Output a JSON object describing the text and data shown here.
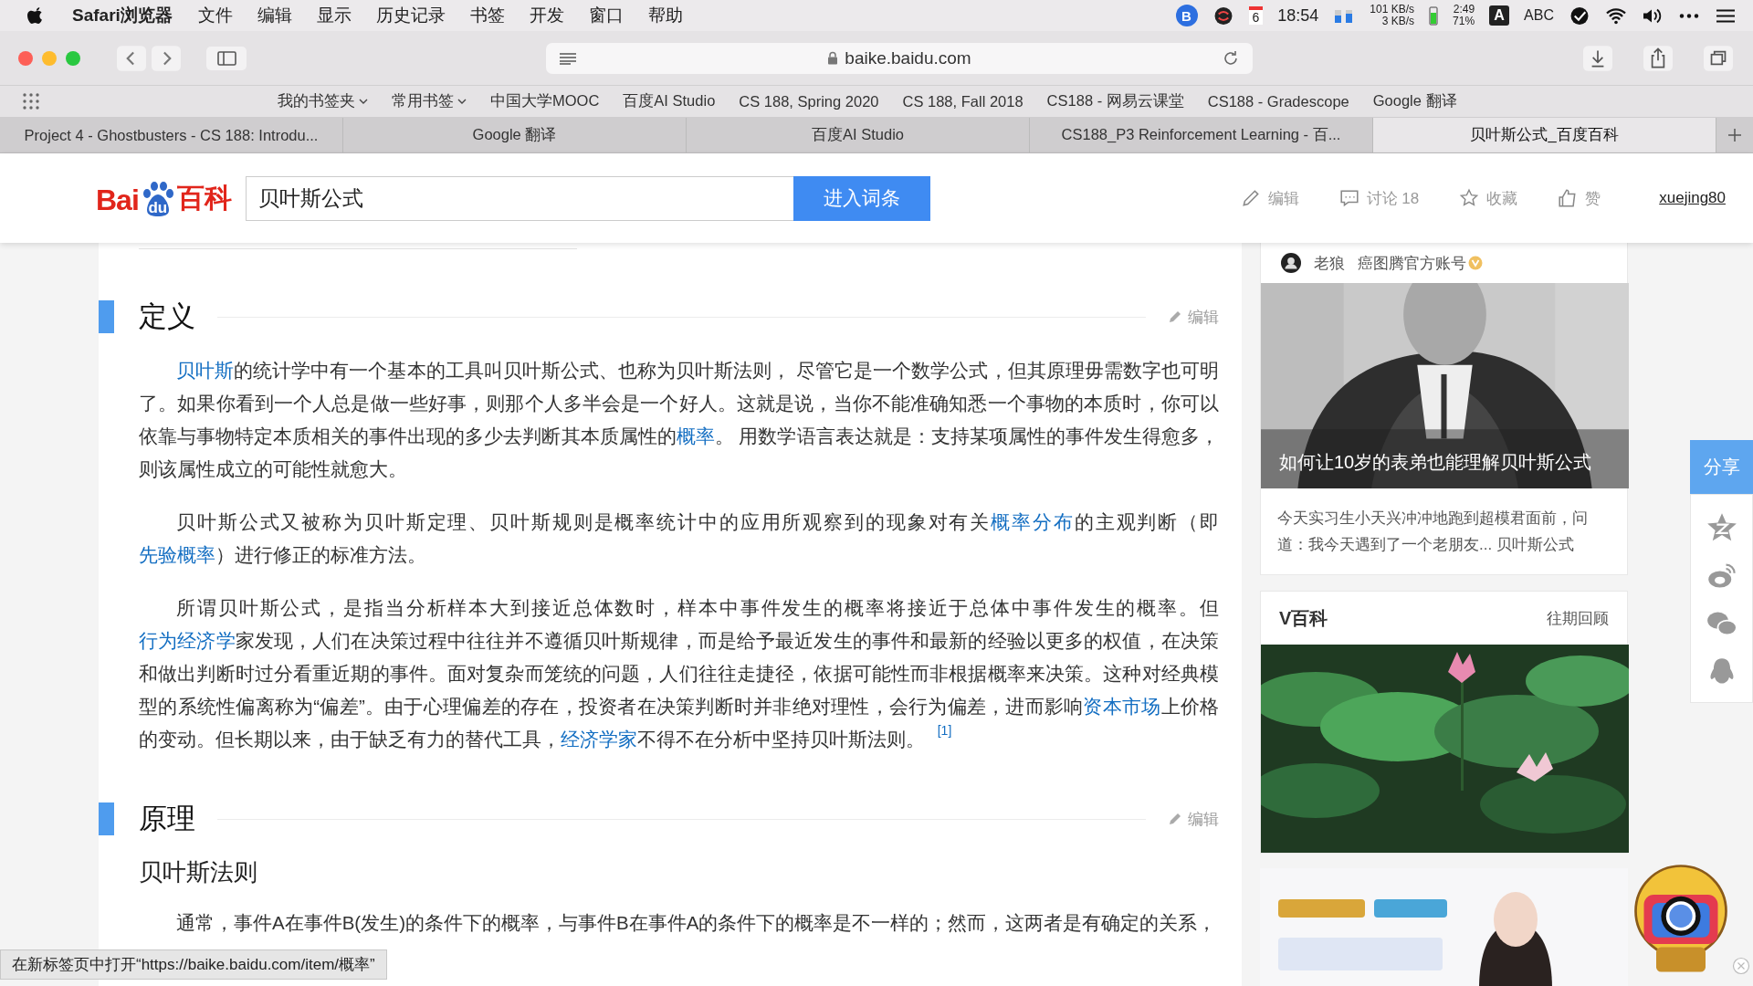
{
  "menu_bar": {
    "app": "Safari浏览器",
    "items": [
      "文件",
      "编辑",
      "显示",
      "历史记录",
      "书签",
      "开发",
      "窗口",
      "帮助"
    ],
    "status": {
      "app_badge": "B",
      "date": "6",
      "time": "18:54",
      "net_up": "101 KB/s",
      "net_down": "3 KB/s",
      "battery_time": "2:49",
      "battery_percent": "71%",
      "input_badge": "A",
      "input": "ABC"
    }
  },
  "toolbar": {
    "url": "baike.baidu.com"
  },
  "bookmarks": [
    {
      "label": "我的书签夹",
      "dropdown": true
    },
    {
      "label": "常用书签",
      "dropdown": true
    },
    {
      "label": "中国大学MOOC",
      "dropdown": false
    },
    {
      "label": "百度AI Studio",
      "dropdown": false
    },
    {
      "label": "CS 188, Spring 2020",
      "dropdown": false
    },
    {
      "label": "CS 188, Fall 2018",
      "dropdown": false
    },
    {
      "label": "CS188 - 网易云课堂",
      "dropdown": false
    },
    {
      "label": "CS188 - Gradescope",
      "dropdown": false
    },
    {
      "label": "Google 翻译",
      "dropdown": false
    }
  ],
  "tabs": [
    {
      "label": "Project 4 - Ghostbusters - CS 188: Introdu...",
      "selected": false
    },
    {
      "label": "Google 翻译",
      "selected": false
    },
    {
      "label": "百度AI Studio",
      "selected": false
    },
    {
      "label": "CS188_P3 Reinforcement Learning - 百...",
      "selected": false
    },
    {
      "label": "贝叶斯公式_百度百科",
      "selected": true
    }
  ],
  "header": {
    "logo": {
      "left": "Bai",
      "paw": "du",
      "right": "百科"
    },
    "search": {
      "value": "贝叶斯公式"
    },
    "search_button": "进入词条",
    "actions": [
      {
        "kind": "edit",
        "label": "编辑"
      },
      {
        "kind": "discuss",
        "label": "讨论 18"
      },
      {
        "kind": "collect",
        "label": "收藏"
      },
      {
        "kind": "like",
        "label": "赞"
      }
    ],
    "user": "xuejing80"
  },
  "article": {
    "sections": [
      {
        "heading": "定义",
        "edit": "编辑",
        "paragraphs": [
          [
            {
              "kind": "link",
              "text": "贝叶斯"
            },
            {
              "kind": "text",
              "text": "的统计学中有一个基本的工具叫贝叶斯公式、也称为贝叶斯法则， 尽管它是一个数学公式，但其原理毋需数字也可明了。如果你看到一个人总是做一些好事，则那个人多半会是一个好人。这就是说，当你不能准确知悉一个事物的本质时，你可以依靠与事物特定本质相关的事件出现的多少去判断其本质属性的"
            },
            {
              "kind": "link",
              "text": "概率"
            },
            {
              "kind": "text",
              "text": "。 用数学语言表达就是：支持某项属性的事件发生得愈多，则该属性成立的可能性就愈大。"
            }
          ],
          [
            {
              "kind": "text",
              "text": "贝叶斯公式又被称为贝叶斯定理、贝叶斯规则是概率统计中的应用所观察到的现象对有关"
            },
            {
              "kind": "link",
              "text": "概率分布"
            },
            {
              "kind": "text",
              "text": "的主观判断（即"
            },
            {
              "kind": "link",
              "text": "先验概率"
            },
            {
              "kind": "text",
              "text": "）进行修正的标准方法。"
            }
          ],
          [
            {
              "kind": "text",
              "text": "所谓贝叶斯公式，是指当分析样本大到接近总体数时，样本中事件发生的概率将接近于总体中事件发生的概率。但"
            },
            {
              "kind": "link",
              "text": "行为经济学"
            },
            {
              "kind": "text",
              "text": "家发现，人们在决策过程中往往并不遵循贝叶斯规律，而是给予最近发生的事件和最新的经验以更多的权值，在决策和做出判断时过分看重近期的事件。面对复杂而笼统的问题，人们往往走捷径，依据可能性而非根据概率来决策。这种对经典模型的系统性偏离称为“偏差”。由于心理偏差的存在，投资者在决策判断时并非绝对理性，会行为偏差，进而影响"
            },
            {
              "kind": "link",
              "text": "资本市场"
            },
            {
              "kind": "text",
              "text": "上价格的变动。但长期以来，由于缺乏有力的替代工具，"
            },
            {
              "kind": "link",
              "text": "经济学家"
            },
            {
              "kind": "text",
              "text": "不得不在分析中坚持贝叶斯法则。 "
            },
            {
              "kind": "ref",
              "text": "[1]"
            }
          ]
        ]
      },
      {
        "heading": "原理",
        "edit": "编辑",
        "subheading": "贝叶斯法则",
        "paragraphs": [
          [
            {
              "kind": "text",
              "text": "通常，事件A在事件B(发生)的条件下的概率，与事件B在事件A的条件下的概率是不一样的；然而，这两者是有确定的关系，"
            }
          ]
        ]
      }
    ]
  },
  "sidebar": {
    "article_card": {
      "author": "老狼",
      "account": "癌图腾官方账号",
      "verified": true,
      "caption": "如何让10岁的表弟也能理解贝叶斯公式",
      "description": "今天实习生小天兴冲冲地跑到超模君面前，问道：我今天遇到了一个老朋友... 贝叶斯公式"
    },
    "video_card": {
      "title": "V百科",
      "more": "往期回顾"
    }
  },
  "share_bar": {
    "label": "分享",
    "icons": [
      {
        "kind": "qzone"
      },
      {
        "kind": "weibo"
      },
      {
        "kind": "wechat"
      },
      {
        "kind": "qq"
      }
    ]
  },
  "link_preview": "在新标签页中打开“https://baike.baidu.com/item/概率”"
}
